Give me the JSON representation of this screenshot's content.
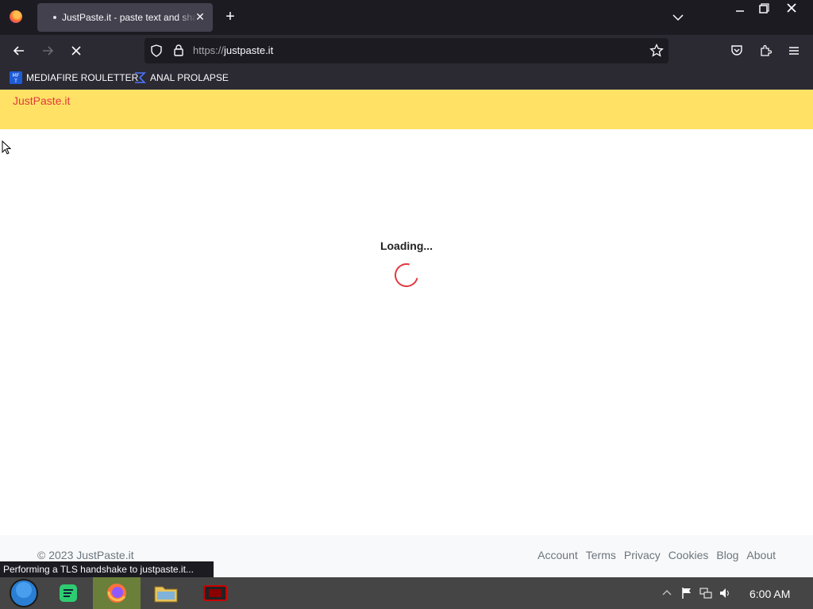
{
  "browser": {
    "tab_title": "JustPaste.it - paste text and share",
    "url_scheme": "https://",
    "url_host": "justpaste.it",
    "status_text": "Performing a TLS handshake to justpaste.it..."
  },
  "bookmarks": [
    {
      "label": "MEDIAFIRE ROULETTER",
      "icon": "mediafire-icon"
    },
    {
      "label": "ANAL PROLAPSE",
      "icon": "bookmark-favicon"
    }
  ],
  "site": {
    "brand": "JustPaste.it",
    "loading_text": "Loading...",
    "copyright": "© 2023 JustPaste.it",
    "footer_links": [
      "Account",
      "Terms",
      "Privacy",
      "Cookies",
      "Blog",
      "About"
    ]
  },
  "taskbar": {
    "clock": "6:00 AM"
  },
  "colors": {
    "header_yellow": "#ffe165",
    "brand_red": "#e1393f",
    "browser_dark": "#2b2a33"
  }
}
